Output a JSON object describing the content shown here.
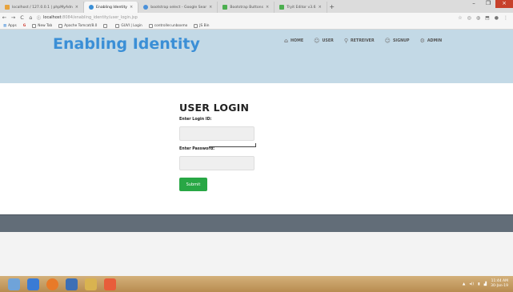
{
  "browser": {
    "tabs": [
      {
        "label": "localhost / 127.0.0.1 | phpMyAdn",
        "active": false,
        "color": "#e8a33d"
      },
      {
        "label": "Enabling Identity",
        "active": true,
        "color": "#3b8fd6"
      },
      {
        "label": "bootstrap select - Google Sear",
        "active": false,
        "color": "#4a90d9"
      },
      {
        "label": "Bootstrap Buttons",
        "active": false,
        "color": "#4caf50"
      },
      {
        "label": "Tryit Editor v3.6",
        "active": false,
        "color": "#4caf50"
      }
    ],
    "new_tab": "+",
    "address": {
      "host": "localhost",
      "path": ":8084/enabling_identity/user_login.jsp"
    },
    "bookmarks": [
      "Apps",
      "G",
      "New Tab",
      "Apache Tomcat/8.0",
      "",
      "GUVI | Login",
      "controller.unboxmo",
      "JS Bin"
    ]
  },
  "site": {
    "brand": "Enabling Identity",
    "nav": [
      {
        "label": "HOME",
        "icon": "home-icon",
        "glyph": "⌂"
      },
      {
        "label": "USER",
        "icon": "user-icon",
        "glyph": "☺"
      },
      {
        "label": "RETREIVER",
        "icon": "search-icon",
        "glyph": "⚲"
      },
      {
        "label": "SIGNUP",
        "icon": "signup-icon",
        "glyph": "☺"
      },
      {
        "label": "ADMIN",
        "icon": "admin-icon",
        "glyph": "⚙"
      }
    ]
  },
  "login": {
    "title": "USER LOGIN",
    "login_label": "Enter Login ID:",
    "password_label": "Enter Password:",
    "login_value": "",
    "password_value": "",
    "submit_label": "Submit",
    "submit_color": "#28a745"
  },
  "taskbar": {
    "time": "11:44 AM",
    "date": "30-Jan-19"
  },
  "colors": {
    "header_bg": "#c3d9e6",
    "brand": "#3b8fd6",
    "footer_band": "#626d78"
  }
}
